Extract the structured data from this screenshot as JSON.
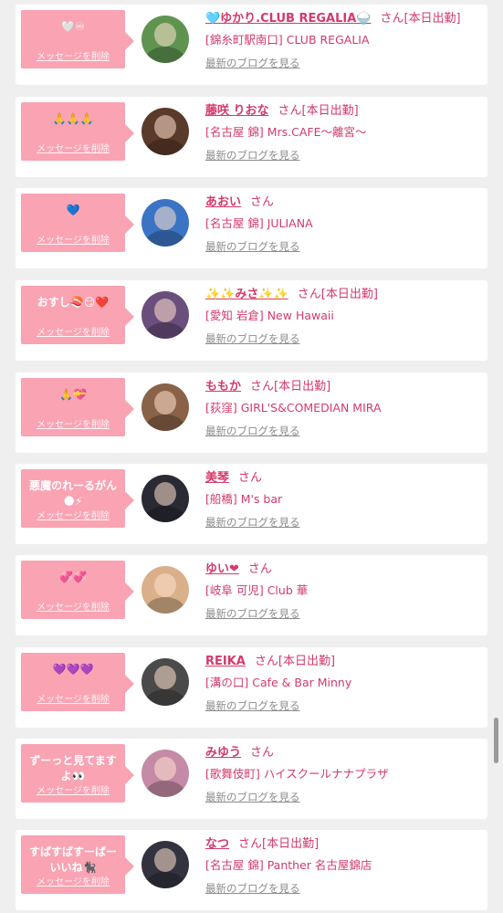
{
  "delete_label": "メッセージを削除",
  "blog_label": "最新のブログを見る",
  "colors": {
    "accent": "#d33a6a",
    "bubble": "#f9a3b3",
    "background": "#efefef"
  },
  "items": [
    {
      "message": "🤍♾",
      "name": "🩵ゆかり.CLUB REGALIA🍚",
      "san": "さん[本日出勤]",
      "shop": "[錦糸町駅南口] CLUB REGALIA",
      "avatar_color": "#5f9450"
    },
    {
      "message": "🙏🙏🙏",
      "name": "藤咲 りおな",
      "san": "さん[本日出勤]",
      "shop": "[名古屋 錦] Mrs.CAFE〜離宮〜",
      "avatar_color": "#5a3a2a"
    },
    {
      "message": "💙",
      "name": "あおい",
      "san": "さん",
      "shop": "[名古屋 錦] JULIANA",
      "avatar_color": "#3b74c4"
    },
    {
      "message": "おすし🍣😏❤️",
      "name": "✨✨みさ✨✨",
      "san": "さん[本日出勤]",
      "shop": "[愛知 岩倉] New Hawaii",
      "avatar_color": "#6a4e7c"
    },
    {
      "message": "🙏💝",
      "name": "ももか",
      "san": "さん[本日出勤]",
      "shop": "[荻窪] GIRL'S&COMEDIAN MIRA",
      "avatar_color": "#8a6248"
    },
    {
      "message": "悪魔のれーるがん\n🌑⚡",
      "name": "美琴",
      "san": "さん",
      "shop": "[船橋] M's bar",
      "avatar_color": "#2a2a35"
    },
    {
      "message": "💞💞",
      "name": "ゆい❤",
      "san": "さん",
      "shop": "[岐阜 可児] Club 華",
      "avatar_color": "#d9b08a"
    },
    {
      "message": "💜💜💜",
      "name": "REIKA",
      "san": "さん[本日出勤]",
      "shop": "[溝の口] Cafe & Bar Minny",
      "avatar_color": "#4a4a4a"
    },
    {
      "message": "ずーっと見てます\nよ👀",
      "name": "みゆう",
      "san": "さん",
      "shop": "[歌舞伎町] ハイスクールナナプラザ",
      "avatar_color": "#c58aa6"
    },
    {
      "message": "すばすばすーぱー\nいいね🐈‍⬛",
      "name": "なつ",
      "san": "さん[本日出勤]",
      "shop": "[名古屋 錦] Panther 名古屋錦店",
      "avatar_color": "#333340"
    }
  ]
}
